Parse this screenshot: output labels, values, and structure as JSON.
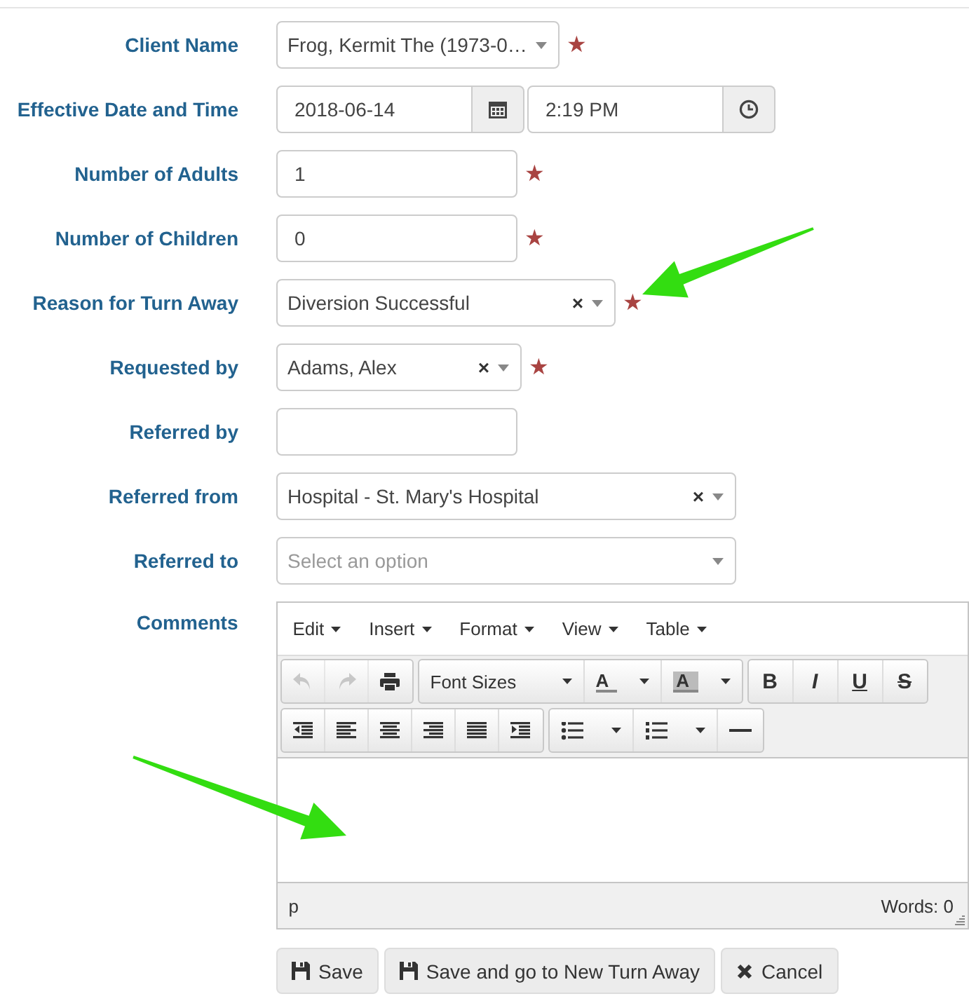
{
  "form": {
    "rows": [
      {
        "label": "Client Name",
        "kind": "select",
        "value": "Frog, Kermit The (1973-0…",
        "required_mark": "★"
      },
      {
        "label": "Effective Date and Time",
        "kind": "datetime",
        "date": "2018-06-14",
        "time": "2:19 PM"
      },
      {
        "label": "Number of Adults",
        "kind": "text",
        "value": "1",
        "required_mark": "★"
      },
      {
        "label": "Number of Children",
        "kind": "text",
        "value": "0",
        "required_mark": "★"
      },
      {
        "label": "Reason for Turn Away",
        "kind": "select",
        "value": "Diversion Successful",
        "clear_button": "×",
        "required_mark": "★"
      },
      {
        "label": "Requested by",
        "kind": "select",
        "value": "Adams, Alex",
        "clear_button": "×",
        "required_mark": "★"
      },
      {
        "label": "Referred by",
        "kind": "text",
        "value": ""
      },
      {
        "label": "Referred from",
        "kind": "select",
        "value": "Hospital - St. Mary's Hospital",
        "clear_button": "×"
      },
      {
        "label": "Referred to",
        "kind": "select",
        "placeholder": "Select an option"
      }
    ]
  },
  "comments": {
    "label": "Comments",
    "menus": [
      "Edit",
      "Insert",
      "Format",
      "View",
      "Table"
    ],
    "toolbar": [
      [
        [
          {
            "kind": "undo",
            "disabled": true
          },
          {
            "kind": "redo",
            "disabled": true
          },
          {
            "kind": "print",
            "disabled": false
          }
        ],
        [
          {
            "kind": "listbox",
            "label": "Font Sizes",
            "disabled": false
          },
          {
            "kind": "forecolor",
            "label": "A",
            "disabled": false
          },
          {
            "kind": "backcolor",
            "label": "A",
            "disabled": false
          }
        ],
        [
          {
            "kind": "bold",
            "label": "B",
            "disabled": false
          },
          {
            "kind": "italic",
            "label": "I",
            "disabled": false
          },
          {
            "kind": "underline",
            "label": "U",
            "disabled": false
          },
          {
            "kind": "strike",
            "label": "S",
            "disabled": false
          }
        ]
      ],
      [
        [
          {
            "kind": "outdent",
            "disabled": false
          },
          {
            "kind": "alignleft",
            "disabled": false
          },
          {
            "kind": "aligncenter",
            "disabled": false
          },
          {
            "kind": "alignright",
            "disabled": false
          },
          {
            "kind": "justify",
            "disabled": false
          },
          {
            "kind": "indent",
            "disabled": false
          }
        ],
        [
          {
            "kind": "bullist",
            "disabled": false
          },
          {
            "kind": "numlist",
            "disabled": false
          },
          {
            "kind": "hr",
            "disabled": false
          }
        ]
      ]
    ],
    "path": "p",
    "word_count": "Words: 0"
  },
  "buttons": [
    {
      "label": "Save",
      "kind": "save"
    },
    {
      "label": "Save and go to New Turn Away",
      "kind": "save"
    },
    {
      "label": "Cancel",
      "kind": "cancel"
    }
  ]
}
